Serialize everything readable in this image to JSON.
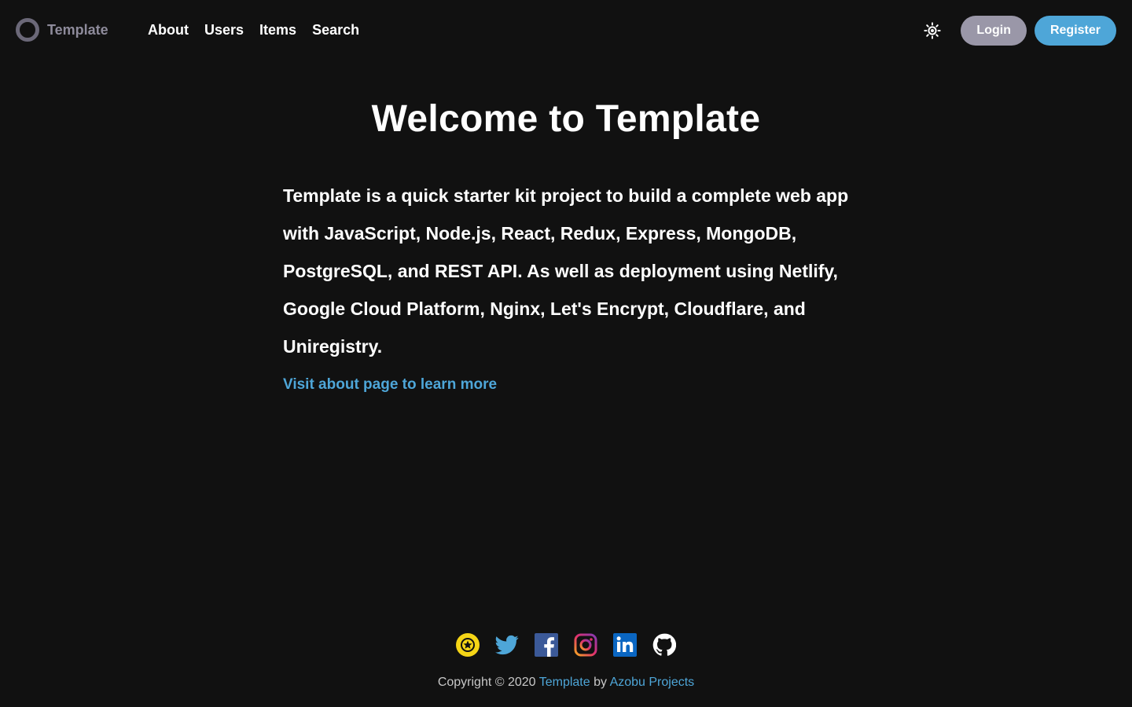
{
  "header": {
    "brand": "Template",
    "nav": [
      "About",
      "Users",
      "Items",
      "Search"
    ],
    "login_label": "Login",
    "register_label": "Register",
    "theme_icon": "sun-icon"
  },
  "main": {
    "title": "Welcome to Template",
    "intro": "Template is a quick starter kit project to build a complete web app with JavaScript, Node.js, React, Redux, Express, MongoDB, PostgreSQL, and REST API. As well as deployment using Netlify, Google Cloud Platform, Nginx, Let's Encrypt, Cloudflare, and Uniregistry.",
    "learn_more": "Visit about page to learn more"
  },
  "footer": {
    "socials": [
      "azobu-icon",
      "twitter-icon",
      "facebook-icon",
      "instagram-icon",
      "linkedin-icon",
      "github-icon"
    ],
    "copyright_prefix": "Copyright © 2020",
    "site_link": "Template",
    "by": "by",
    "author_link": "Azobu Projects"
  },
  "colors": {
    "background": "#111111",
    "accent": "#4ea6d8",
    "login_button": "#9a97a8",
    "brand_text": "#8e8b9b"
  }
}
